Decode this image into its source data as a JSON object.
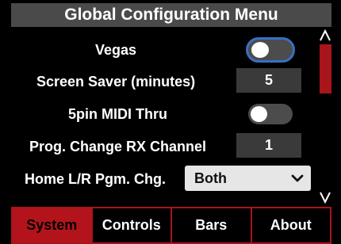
{
  "title": "Global Configuration Menu",
  "rows": {
    "vegas": {
      "label": "Vegas",
      "value": "off"
    },
    "screen_saver": {
      "label": "Screen Saver (minutes)",
      "value": "5"
    },
    "midi_thru": {
      "label": "5pin MIDI Thru",
      "value": "off"
    },
    "prog_change": {
      "label": "Prog. Change RX Channel",
      "value": "1"
    },
    "home_lr": {
      "label": "Home L/R Pgm. Chg.",
      "value": "Both"
    }
  },
  "scrollbar": {
    "up_glyph": "Λ",
    "down_glyph": "V"
  },
  "tabs": [
    {
      "label": "System",
      "active": true
    },
    {
      "label": "Controls",
      "active": false
    },
    {
      "label": "Bars",
      "active": false
    },
    {
      "label": "About",
      "active": false
    }
  ],
  "colors": {
    "title_bg": "#4a4a4a",
    "accent_red": "#b3141b",
    "focus_blue": "#3a6fc4",
    "value_box_bg": "#3a3a3a",
    "select_bg": "#e6e6e6"
  },
  "icons": {
    "select_chevron": "chevron-down-icon",
    "scroll_up": "scroll-up-arrow-icon",
    "scroll_down": "scroll-down-arrow-icon"
  }
}
